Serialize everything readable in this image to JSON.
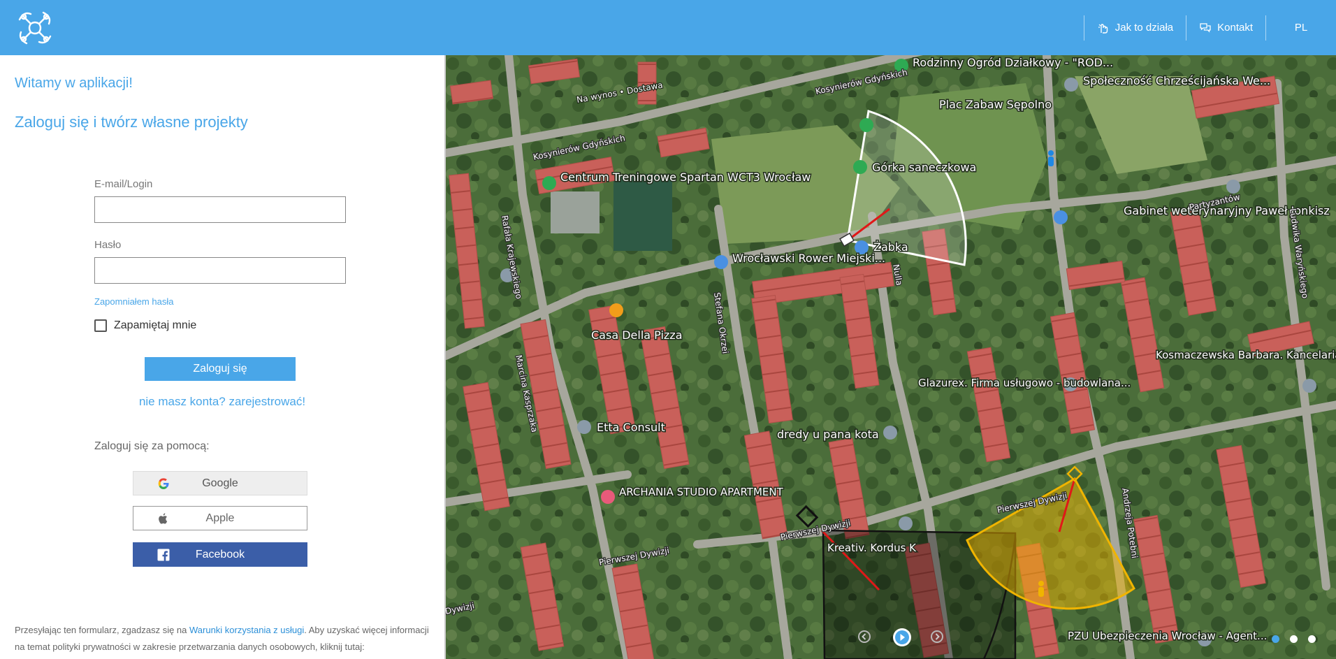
{
  "header": {
    "nav": {
      "how_it_works": "Jak to działa",
      "contact": "Kontakt",
      "language": "PL"
    }
  },
  "login": {
    "welcome": "Witamy w aplikacji!",
    "subtitle": "Zaloguj się i twórz własne projekty",
    "email_label": "E-mail/Login",
    "email_value": "",
    "password_label": "Hasło",
    "password_value": "",
    "forgot_password": "Zapomniałem hasła",
    "remember_me": "Zapamiętaj mnie",
    "remember_checked": false,
    "submit": "Zaloguj się",
    "register": "nie masz konta? zarejestrować!",
    "social_title": "Zaloguj się za pomocą:",
    "google": "Google",
    "apple": "Apple",
    "facebook": "Facebook",
    "footer_part1": "Przesyłając ten formularz, zgadzasz się na ",
    "footer_link": "Warunki korzystania z usługi",
    "footer_part2": ". Aby uzyskać więcej informacji na temat polityki prywatności w zakresie przetwarzania danych osobowych, kliknij tutaj:"
  },
  "map": {
    "labels": {
      "rod": "Rodzinny Ogród Działkowy - \"ROD...",
      "community": "Społeczność Chrześcijańska We...",
      "playground": "Plac Zabaw Sępolno",
      "gorka": "Górka saneczkowa",
      "centrum": "Centrum Treningowe Spartan WCT3 Wrocław",
      "gabinet": "Gabinet weterynaryjny Paweł Jonkisz",
      "zabka": "Żabka",
      "rower": "Wrocławski Rower Miejski...",
      "casa": "Casa Della Pizza",
      "casa_sub": "Na wynos • Dostawa",
      "kosmaczewska": "Kosmaczewska Barbara. Kancelaria...",
      "glazurex": "Glazurex. Firma usługowo - budowlana...",
      "etta": "Etta Consult",
      "dredy": "dredy u pana kota",
      "archania": "ARCHANIA STUDIO APARTMENT",
      "kreativ": "Kreativ. Kordus K",
      "pzu": "PZU Ubezpieczenia Wrocław - Agent..."
    },
    "streets": {
      "kosynierow1": "Kosynierów Gdyńskich",
      "kosynierow2": "Kosynierów Gdyńskich",
      "partyzantow": "Partyzantów",
      "pierwszej1": "Pierwszej Dywizji",
      "pierwszej2": "Pierwszej Dywizji",
      "pierwszej3": "Pierwszej Dywizji",
      "andrzeja": "Andrzeja Potebni",
      "stefana": "Stefana Okrzei",
      "marcina": "Marcina Kasprzaka",
      "rafala": "Rafała Krajewskiego",
      "ludwika": "Ludwika Waryńskiego",
      "nulla": "Nulla",
      "dywizji": "Dywizji"
    }
  },
  "colors": {
    "primary": "#49a6e8",
    "facebook": "#3b5ea8",
    "camera_fill": "#f0b400",
    "view_line": "#e01818"
  }
}
